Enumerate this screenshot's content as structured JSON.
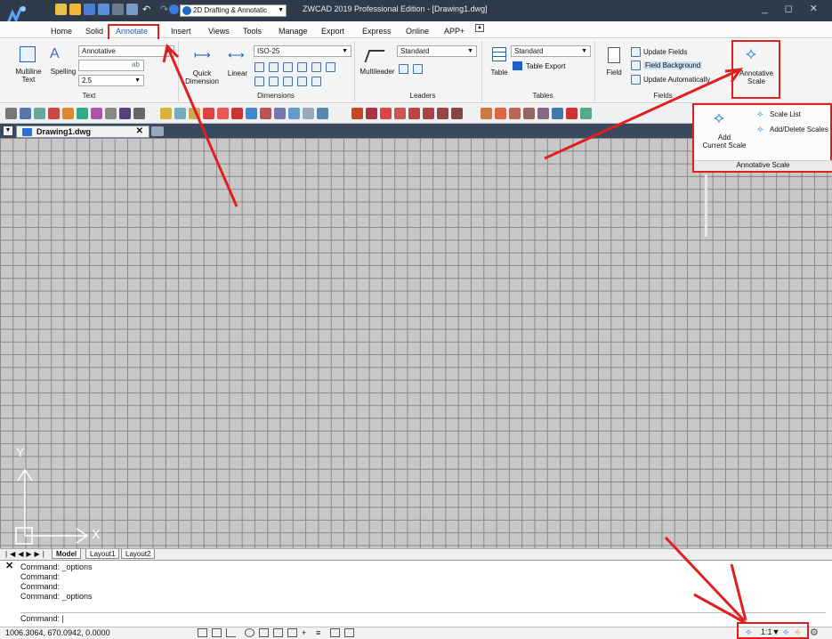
{
  "titlebar": {
    "workspace": "2D Drafting & Annotatic",
    "title": "ZWCAD 2019 Professional Edition - [Drawing1.dwg]",
    "window_buttons": "_ ◻ ✕"
  },
  "tabs": [
    "Home",
    "Solid",
    "Annotate",
    "Insert",
    "Views",
    "Tools",
    "Manage",
    "Export",
    "Express",
    "Online",
    "APP+"
  ],
  "ribbon": {
    "text": {
      "style_value": "Annotative",
      "height_value": "2.5",
      "multiline_label": "Multiline\nText",
      "spelling_label": "Spelling",
      "section": "Text"
    },
    "dimensions": {
      "style_value": "ISO-25",
      "quick_label": "Quick\nDimension",
      "linear_label": "Linear",
      "section": "Dimensions"
    },
    "leaders": {
      "style_value": "Standard",
      "multileader_label": "Multileader",
      "section": "Leaders"
    },
    "tables": {
      "style_value": "Standard",
      "table_label": "Table",
      "export_label": "Table Export",
      "section": "Tables"
    },
    "fields": {
      "field_label": "Field",
      "update_fields": "Update Fields",
      "field_background": "Field Background",
      "update_auto": "Update Automatically",
      "section": "Fields"
    },
    "annotative_scale_label": "Annotative\nScale"
  },
  "popup": {
    "add_current_scale": "Add\nCurrent Scale",
    "scale_list": "Scale List",
    "add_delete_scales": "Add/Delete Scales",
    "footer": "Annotative Scale"
  },
  "doc_tab": "Drawing1.dwg",
  "layout_tabs": [
    "Model",
    "Layout1",
    "Layout2"
  ],
  "ucs": {
    "y": "Y",
    "x": "X"
  },
  "command_history": [
    "Command: _options",
    "Command:",
    "Command:",
    "Command: _options"
  ],
  "command_prompt": "Command:",
  "coordinates": "1006.3064, 670.0942, 0.0000",
  "annotation_scale": "1:1",
  "colors": {
    "titlebar": "#2f3b4a",
    "accent": "#1c62c8",
    "highlight": "#e02020",
    "canvas": "#c8c8c8",
    "grid": "#888888"
  }
}
